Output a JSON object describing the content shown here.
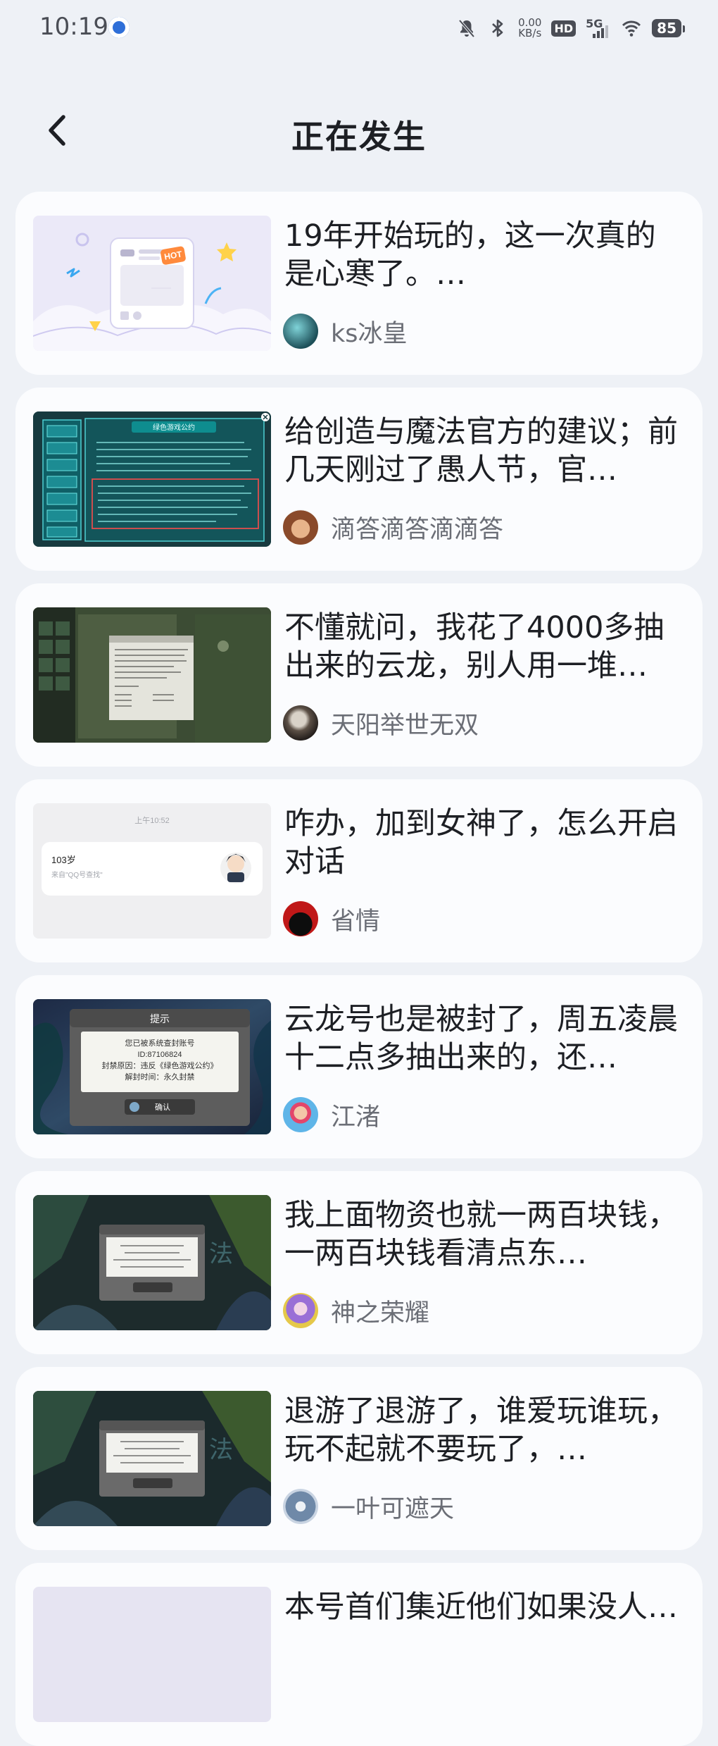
{
  "status_bar": {
    "time": "10:19",
    "net_speed_value": "0.00",
    "net_speed_unit": "KB/s",
    "hd_label": "HD",
    "signal_label": "5G",
    "battery": "85",
    "icons": [
      "notification-app-icon",
      "mute-icon",
      "bluetooth-icon",
      "wifi-icon"
    ]
  },
  "header": {
    "title": "正在发生",
    "back_icon": "chevron-left-icon"
  },
  "posts": [
    {
      "title": "19年开始玩的，这一次真的是心寒了。…",
      "author": "ks冰皇",
      "thumb": "hot-card-illustration"
    },
    {
      "title": "给创造与魔法官方的建议；前几天刚过了愚人节，官…",
      "author": "滴答滴答滴滴答",
      "thumb": "game-rules-screenshot"
    },
    {
      "title": "不懂就问，我花了4000多抽出来的云龙，别人用一堆…",
      "author": "天阳举世无双",
      "thumb": "game-dialog-screenshot"
    },
    {
      "title": "咋办，加到女神了，怎么开启对话",
      "author": "省情",
      "thumb": "chat-notification-screenshot"
    },
    {
      "title": "云龙号也是被封了，周五凌晨十二点多抽出来的，还…",
      "author": "江渚",
      "thumb": "ban-notice-screenshot"
    },
    {
      "title": "我上面物资也就一两百块钱，一两百块钱看清点东…",
      "author": "神之荣耀",
      "thumb": "ban-notice-screenshot"
    },
    {
      "title": "退游了退游了，谁爱玩谁玩，玩不起就不要玩了，…",
      "author": "一叶可遮天",
      "thumb": "ban-notice-screenshot"
    },
    {
      "title": "本号首们集近他们如果没人…",
      "author": "",
      "thumb": "partial-card"
    }
  ],
  "thumb_text": {
    "hot_badge": "HOT",
    "chat_time": "上午10:52",
    "chat_name": "103岁",
    "chat_source": "来自\"QQ号查找\"",
    "ban_title": "提示",
    "ban_line1": "您已被系统查封账号",
    "ban_line2": "ID:87106824",
    "ban_line3": "封禁原因：违反《绿色游戏公约》",
    "ban_line4": "解封时间：永久封禁",
    "ban_button": "确认",
    "rules_title": "绿色游戏公约"
  },
  "colors": {
    "background": "#eef1f6",
    "card": "#fbfcfe",
    "title_text": "#1d1f24",
    "author_text": "#6b6e76"
  }
}
